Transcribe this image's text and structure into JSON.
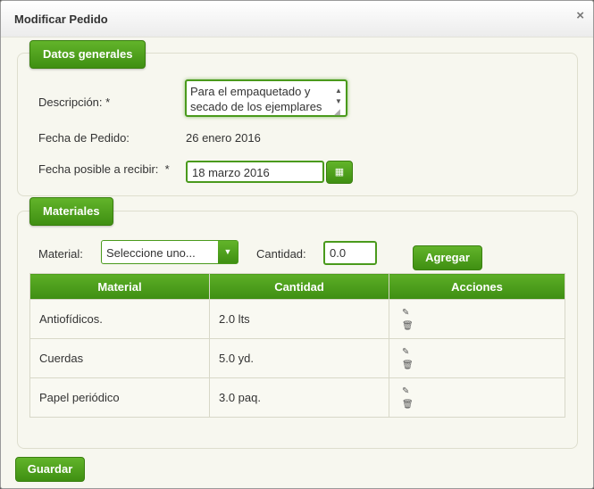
{
  "dialog": {
    "title": "Modificar Pedido",
    "close_icon": "×"
  },
  "general": {
    "legend": "Datos generales",
    "description_label": "Descripción:",
    "required_mark": "*",
    "description_value": "Para el empaquetado y secado de los ejemplares",
    "order_date_label": "Fecha de Pedido:",
    "order_date_value": "26 enero 2016",
    "receive_date_label": "Fecha posible a recibir:",
    "receive_date_value": "18 marzo 2016"
  },
  "materials": {
    "legend": "Materiales",
    "material_label": "Material:",
    "material_select_value": "Seleccione uno...",
    "quantity_label": "Cantidad:",
    "quantity_value": "0.0",
    "add_button": "Agregar",
    "table": {
      "headers": [
        "Material",
        "Cantidad",
        "Acciones"
      ],
      "rows": [
        {
          "material": "Antiofídicos.",
          "cantidad": "2.0 lts"
        },
        {
          "material": "Cuerdas",
          "cantidad": "5.0 yd."
        },
        {
          "material": "Papel periódico",
          "cantidad": "3.0 paq."
        }
      ]
    }
  },
  "footer": {
    "save_button": "Guardar"
  },
  "colors": {
    "accent": "#4a9a1c",
    "accent_dark": "#3a7f10",
    "panel_bg": "#f7f7ef"
  },
  "icons": {
    "calendar": "calendar-icon",
    "edit": "pencil-icon",
    "delete": "trash-icon",
    "dropdown": "caret-down-icon"
  }
}
